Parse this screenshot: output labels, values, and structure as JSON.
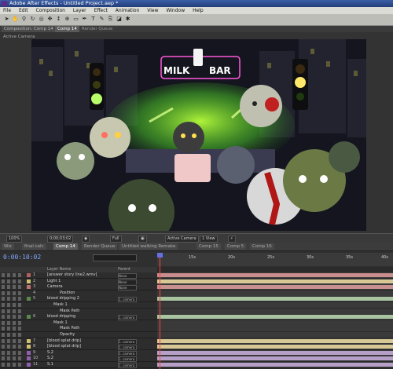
{
  "window": {
    "title": "Adobe After Effects - Untitled Project.aep *"
  },
  "menu": [
    "File",
    "Edit",
    "Composition",
    "Layer",
    "Effect",
    "Animation",
    "View",
    "Window",
    "Help"
  ],
  "composition_panel": {
    "tab_label": "Composition: Comp 14",
    "comp_tab": "Comp 14",
    "extra_tab": "Render Queue",
    "view_label": "Active Camera"
  },
  "scene": {
    "sign_milk": "MILK",
    "sign_bar": "BAR"
  },
  "viewer_bar": {
    "zoom": "100%",
    "timecode": "0;00;03;02",
    "resolution": "Full",
    "camera": "Active Camera",
    "views": "1 View"
  },
  "timeline": {
    "tabs": [
      "Wiz",
      "final calc",
      "Comp 14",
      "Render Queue",
      "Untitled walking Remake",
      "Comp 15",
      "Comp 5",
      "Comp 16"
    ],
    "current_time": "0:00:10:02",
    "ruler_ticks": [
      "15s",
      "20s",
      "25s",
      "30s",
      "35s",
      "40s"
    ],
    "columns": {
      "layer_name": "Layer Name",
      "parent": "Parent"
    },
    "layers": [
      {
        "num": "1",
        "name": "[answer story line2.wmv]",
        "mode": "None",
        "swatch": "#b06060",
        "indent": 0,
        "bar": "#c98d8d"
      },
      {
        "num": "2",
        "name": "Light 1",
        "mode": "None",
        "swatch": "#d0c070",
        "indent": 0,
        "bar": "#d8c896"
      },
      {
        "num": "3",
        "name": "Camera",
        "mode": "None",
        "swatch": "#c07070",
        "indent": 0,
        "bar": "#c99090"
      },
      {
        "num": "4",
        "name": "Position",
        "mode": "",
        "swatch": "",
        "indent": 2,
        "bar": ""
      },
      {
        "num": "5",
        "name": "blood dripping 2",
        "mode": "1. camera",
        "swatch": "#5a8a4a",
        "indent": 0,
        "bar": "#a9c4a0"
      },
      {
        "num": "",
        "name": "Mask 1",
        "mode": "",
        "swatch": "",
        "indent": 1,
        "bar": ""
      },
      {
        "num": "",
        "name": "Mask Path",
        "mode": "",
        "swatch": "",
        "indent": 2,
        "bar": ""
      },
      {
        "num": "6",
        "name": "blood dripping",
        "mode": "1. camera",
        "swatch": "#5a8a4a",
        "indent": 0,
        "bar": "#a9c4a0"
      },
      {
        "num": "",
        "name": "Mask 1",
        "mode": "",
        "swatch": "",
        "indent": 1,
        "bar": ""
      },
      {
        "num": "",
        "name": "Mask Path",
        "mode": "",
        "swatch": "",
        "indent": 2,
        "bar": ""
      },
      {
        "num": "",
        "name": "Opacity",
        "mode": "",
        "swatch": "",
        "indent": 2,
        "bar": ""
      },
      {
        "num": "7",
        "name": "[blood splat drip]",
        "mode": "1. camera",
        "swatch": "#d0c070",
        "indent": 0,
        "bar": "#d8c896"
      },
      {
        "num": "8",
        "name": "[blood splat drip]",
        "mode": "1. camera",
        "swatch": "#d0c070",
        "indent": 0,
        "bar": "#d8c896"
      },
      {
        "num": "9",
        "name": "S.2",
        "mode": "1. camera",
        "swatch": "#9060b0",
        "indent": 0,
        "bar": "#b7a0c8"
      },
      {
        "num": "10",
        "name": "S.2",
        "mode": "1. camera",
        "swatch": "#9060b0",
        "indent": 0,
        "bar": "#b7a0c8"
      },
      {
        "num": "11",
        "name": "S.1",
        "mode": "1. camera",
        "swatch": "#9060b0",
        "indent": 0,
        "bar": "#b7a0c8"
      }
    ]
  }
}
